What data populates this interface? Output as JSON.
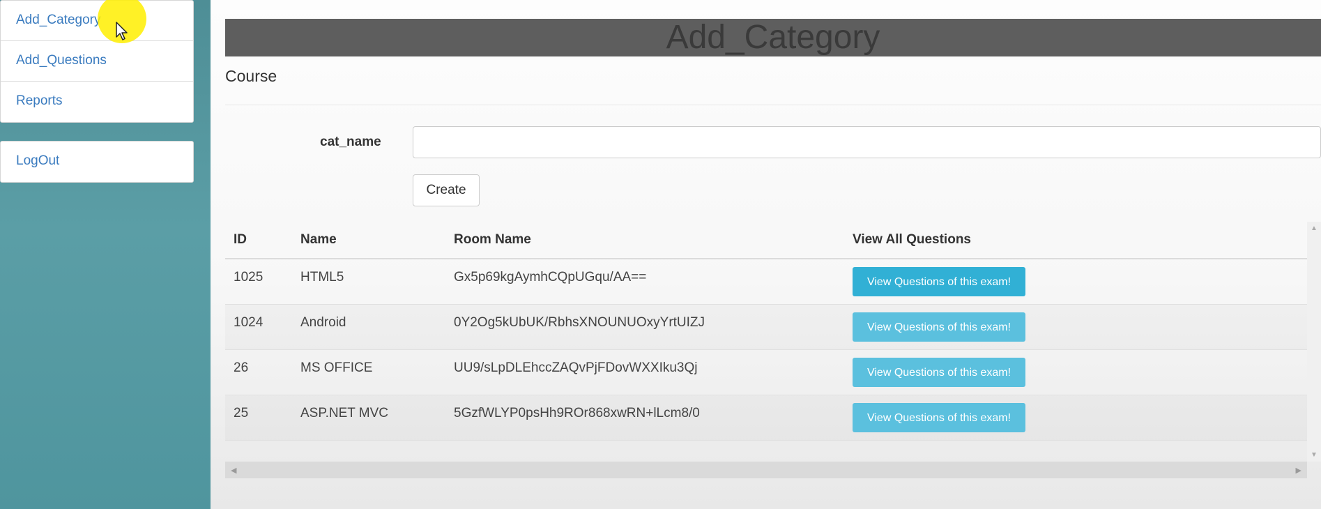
{
  "sidebar": {
    "items": [
      {
        "label": "Add_Category"
      },
      {
        "label": "Add_Questions"
      },
      {
        "label": "Reports"
      }
    ],
    "logout_label": "LogOut"
  },
  "header": {
    "title": "Add_Category",
    "subtitle": "Course"
  },
  "form": {
    "field_label": "cat_name",
    "field_value": "",
    "create_label": "Create"
  },
  "table": {
    "columns": [
      "ID",
      "Name",
      "Room Name",
      "View All Questions"
    ],
    "rows": [
      {
        "id": "1025",
        "name": "HTML5",
        "room": "Gx5p69kgAymhCQpUGqu/AA==",
        "action": "View Questions of this exam!"
      },
      {
        "id": "1024",
        "name": "Android",
        "room": "0Y2Og5kUbUK/RbhsXNOUNUOxyYrtUIZJ",
        "action": "View Questions of this exam!"
      },
      {
        "id": "26",
        "name": "MS OFFICE",
        "room": "UU9/sLpDLEhccZAQvPjFDovWXXIku3Qj",
        "action": "View Questions of this exam!"
      },
      {
        "id": "25",
        "name": "ASP.NET MVC",
        "room": "5GzfWLYP0psHh9ROr868xwRN+lLcm8/0",
        "action": "View Questions of this exam!"
      }
    ]
  },
  "colors": {
    "sidebar_bg": "#5b9ea6",
    "link": "#3a7bbf",
    "button_info": "#5bc0de",
    "title_bar": "#5e5e5e"
  }
}
